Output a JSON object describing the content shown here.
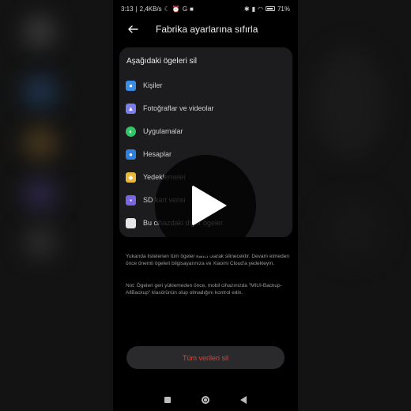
{
  "status_bar": {
    "time": "3:13",
    "network_speed": "2,4KB/s",
    "battery": "71"
  },
  "header": {
    "back_icon": "arrow-left-icon",
    "title": "Fabrika ayarlarına sıfırla"
  },
  "card": {
    "title": "Aşağıdaki ögeleri sil",
    "items": [
      {
        "label": "Kişiler",
        "icon": "contacts-icon",
        "color": "#3a8ee6"
      },
      {
        "label": "Fotoğraflar ve videolar",
        "icon": "gallery-icon",
        "color": "#7c7ee8"
      },
      {
        "label": "Uygulamalar",
        "icon": "apps-icon",
        "color": "#35c467"
      },
      {
        "label": "Hesaplar",
        "icon": "accounts-icon",
        "color": "#2f7fe0"
      },
      {
        "label": "Yedeklemeler",
        "icon": "backup-icon",
        "color": "#e8b93a"
      },
      {
        "label": "SD kart verisi",
        "icon": "sd-card-icon",
        "color": "#7867e0"
      },
      {
        "label": "Bu cihazdaki diğer ögeler",
        "icon": "other-items-icon",
        "color": "#e6e6e6"
      }
    ]
  },
  "notes": {
    "warning": "Yukarıda listelenen tüm ögeler kalıcı olarak silinecektir. Devam etmeden önce önemli ögeleri bilgisayarınıza ve Xiaomi Cloud'a yedekleyin.",
    "backup_note": "Not: Ögeleri geri yüklemeden önce, mobil cihazınızda \"MIUI-Backup-AllBackup\" klasörünün olup olmadığını kontrol edin."
  },
  "reset_button": {
    "label": "Tüm verileri sil"
  },
  "colors": {
    "accent_red": "#e0403c",
    "card_bg": "#1c1c1e"
  }
}
